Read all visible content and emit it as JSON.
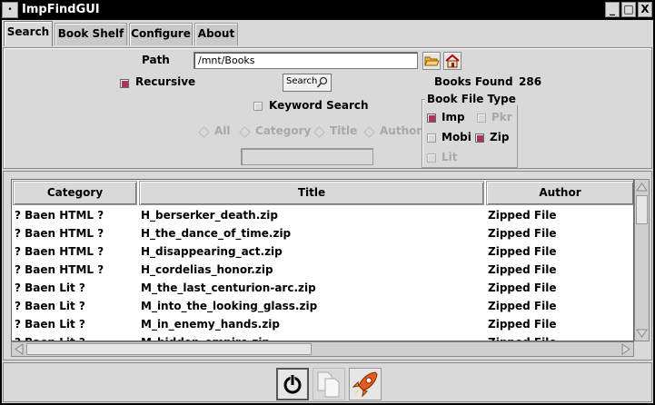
{
  "window": {
    "title": "ImpFindGUI",
    "menu_glyph": "•",
    "minimize_glyph": "_",
    "maximize_glyph": "□",
    "close_glyph": "X"
  },
  "tabs": [
    {
      "label": "Search",
      "active": true
    },
    {
      "label": "Book Shelf",
      "active": false
    },
    {
      "label": "Configure",
      "active": false
    },
    {
      "label": "About",
      "active": false
    }
  ],
  "search": {
    "path_label": "Path",
    "path_value": "/mnt/Books",
    "recursive_label": "Recursive",
    "recursive_checked": true,
    "search_button_label": "Search",
    "books_found_label": "Books Found",
    "books_found_count": "286",
    "keyword_search_label": "Keyword Search",
    "keyword_search_checked": false,
    "keyword_value": "",
    "scope_options": [
      "All",
      "Category",
      "Title",
      "Author"
    ],
    "file_type": {
      "title": "Book File Type",
      "options": [
        {
          "label": "Imp",
          "checked": true,
          "enabled": true
        },
        {
          "label": "Pkr",
          "checked": false,
          "enabled": false
        },
        {
          "label": "Mobi",
          "checked": false,
          "enabled": true
        },
        {
          "label": "Zip",
          "checked": true,
          "enabled": true
        },
        {
          "label": "Lit",
          "checked": false,
          "enabled": false
        }
      ]
    }
  },
  "table": {
    "columns": [
      "Category",
      "Title",
      "Author"
    ],
    "rows": [
      [
        "? Baen HTML ?",
        "H_berserker_death.zip",
        "Zipped File"
      ],
      [
        "? Baen HTML ?",
        "H_the_dance_of_time.zip",
        "Zipped File"
      ],
      [
        "? Baen HTML ?",
        "H_disappearing_act.zip",
        "Zipped File"
      ],
      [
        "? Baen HTML ?",
        "H_cordelias_honor.zip",
        "Zipped File"
      ],
      [
        "? Baen Lit ?",
        "M_the_last_centurion-arc.zip",
        "Zipped File"
      ],
      [
        "? Baen Lit ?",
        "M_into_the_looking_glass.zip",
        "Zipped File"
      ],
      [
        "? Baen Lit ?",
        "M_in_enemy_hands.zip",
        "Zipped File"
      ],
      [
        "? Baen Lit ?",
        "M_hidden_empire.zip",
        "Zipped File"
      ]
    ]
  },
  "colors": {
    "accent": "#b03060",
    "background": "#d9d9d9"
  },
  "icons": {
    "folder": "folder-open-icon",
    "home": "home-icon",
    "search": "magnifier-icon",
    "power": "power-icon",
    "copy": "copy-icon",
    "launch": "rocket-icon"
  }
}
